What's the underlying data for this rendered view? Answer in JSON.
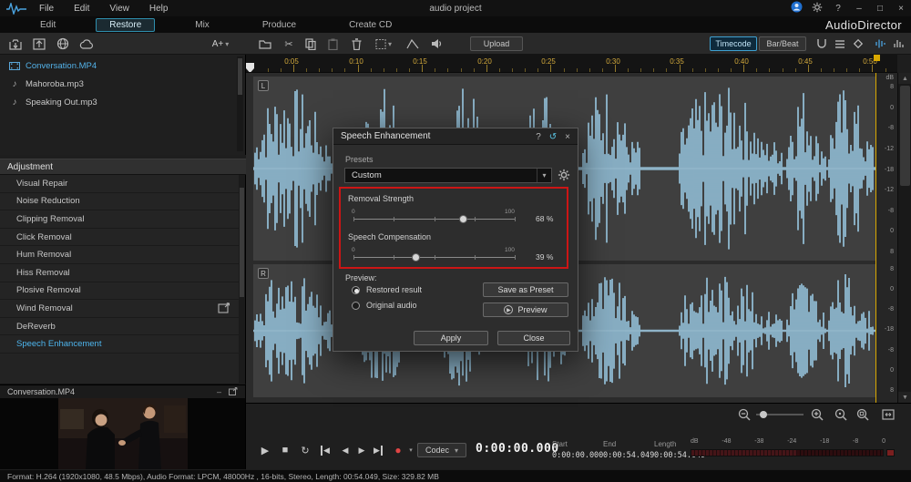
{
  "window": {
    "menus": [
      "File",
      "Edit",
      "View",
      "Help"
    ],
    "title": "audio project",
    "brand": "AudioDirector"
  },
  "tabs": {
    "edit": "Edit",
    "restore": "Restore",
    "mix": "Mix",
    "produce": "Produce",
    "create_cd": "Create CD"
  },
  "toolbar": {
    "font_tool": "A+",
    "upload": "Upload",
    "timecode": "Timecode",
    "bar_beat": "Bar/Beat"
  },
  "library": {
    "items": [
      {
        "name": "Conversation.MP4",
        "type": "video"
      },
      {
        "name": "Mahoroba.mp3",
        "type": "audio"
      },
      {
        "name": "Speaking Out.mp3",
        "type": "audio"
      }
    ]
  },
  "adjustment": {
    "title": "Adjustment",
    "items": [
      "Visual Repair",
      "Noise Reduction",
      "Clipping Removal",
      "Click Removal",
      "Hum Removal",
      "Hiss Removal",
      "Plosive Removal",
      "Wind Removal",
      "DeReverb",
      "Speech Enhancement"
    ]
  },
  "preview": {
    "title": "Conversation.MP4"
  },
  "timeline": {
    "labels": [
      "0:05",
      "0:10",
      "0:15",
      "0:20",
      "0:25",
      "0:30",
      "0:35",
      "0:40",
      "0:45",
      "0:50"
    ]
  },
  "channels": [
    "L",
    "R"
  ],
  "scales": {
    "unit": "dB",
    "ch1": [
      "8",
      "0",
      "-8",
      "-12",
      "-18",
      "-12",
      "-8",
      "0",
      "8"
    ],
    "ch2": [
      "8",
      "0",
      "-8",
      "-18",
      "-8",
      "0",
      "8"
    ]
  },
  "dialog": {
    "title": "Speech Enhancement",
    "presets_label": "Presets",
    "preset_value": "Custom",
    "sliders": [
      {
        "label": "Removal Strength",
        "min": "0",
        "max": "100",
        "value": 68,
        "display": "68 %"
      },
      {
        "label": "Speech Compensation",
        "min": "0",
        "max": "100",
        "value": 39,
        "display": "39 %"
      }
    ],
    "preview_label": "Preview:",
    "radios": [
      {
        "label": "Restored result",
        "selected": true
      },
      {
        "label": "Original audio",
        "selected": false
      }
    ],
    "save_preset": "Save as Preset",
    "preview_btn": "Preview",
    "apply": "Apply",
    "close": "Close"
  },
  "transport": {
    "codec": "Codec",
    "time": "0:00:00.000",
    "fields": [
      {
        "label": "Start",
        "value": "0:00:00.000"
      },
      {
        "label": "End",
        "value": "0:00:54.049"
      },
      {
        "label": "Length",
        "value": "0:00:54.049"
      }
    ],
    "meter_labels": [
      "dB",
      "-48",
      "-38",
      "-24",
      "-18",
      "-8",
      "0"
    ]
  },
  "status": "Format: H.264 (1920x1080, 48.5 Mbps), Audio Format: LPCM, 48000Hz , 16-bits, Stereo, Length: 00:54.049, Size: 329.82 MB",
  "colors": {
    "accent": "#3fa0d0",
    "waveform": "#9fd2ee",
    "highlight": "#cc1515",
    "ruler_text": "#d2a93c"
  }
}
